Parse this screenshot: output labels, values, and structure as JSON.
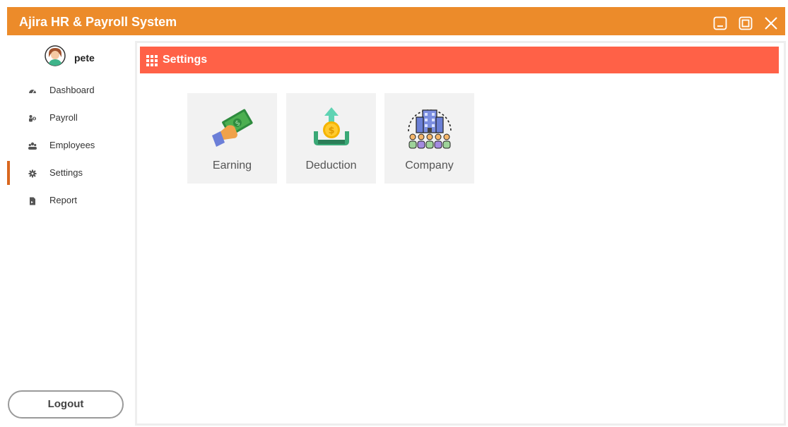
{
  "window": {
    "title": "Ajira HR & Payroll System",
    "controls": [
      "minimize-icon",
      "maximize-icon",
      "close-icon"
    ]
  },
  "user": {
    "name": "pete",
    "avatar_icon": "user-avatar-icon"
  },
  "sidebar": {
    "items": [
      {
        "label": "Dashboard",
        "icon": "dashboard-icon",
        "active": false
      },
      {
        "label": "Payroll",
        "icon": "payroll-icon",
        "active": false
      },
      {
        "label": "Employees",
        "icon": "employees-icon",
        "active": false
      },
      {
        "label": "Settings",
        "icon": "gear-icon",
        "active": true
      },
      {
        "label": "Report",
        "icon": "report-icon",
        "active": false
      }
    ],
    "logout_label": "Logout"
  },
  "main": {
    "header_title": "Settings",
    "header_icon": "grid-icon",
    "tiles": [
      {
        "label": "Earning",
        "icon": "money-hand-icon"
      },
      {
        "label": "Deduction",
        "icon": "coin-deduction-icon"
      },
      {
        "label": "Company",
        "icon": "company-building-icon"
      }
    ]
  },
  "colors": {
    "titlebar": "#ec8b2a",
    "header": "#ff6147",
    "active_indicator": "#d9671f",
    "tile_bg": "#f2f2f2"
  }
}
